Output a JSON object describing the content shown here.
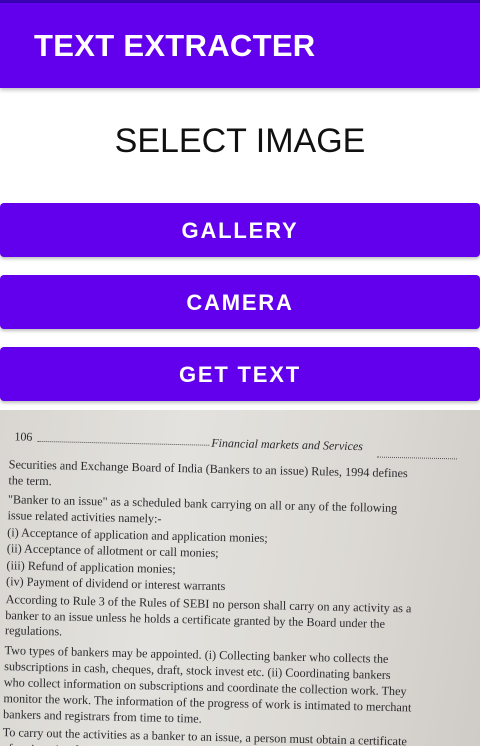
{
  "app_bar": {
    "title": "TEXT EXTRACTER"
  },
  "heading": "SELECT IMAGE",
  "buttons": {
    "gallery": "GALLERY",
    "camera": "CAMERA",
    "get_text": "GET TEXT"
  },
  "photo": {
    "page_number": "106",
    "running_header": "Financial markets and Services",
    "lines": [
      "Securities and Exchange Board of India (Bankers to an issue) Rules, 1994 defines",
      "the term.",
      "\"Banker to an issue\" as a scheduled bank carrying on all or any of the following",
      "issue related activities namely:-",
      "(i) Acceptance of application and application monies;",
      "(ii) Acceptance of allotment or call monies;",
      "(iii) Refund of application monies;",
      "(iv) Payment of dividend or interest warrants",
      "According to Rule 3 of the Rules of SEBI no person shall carry on any activity as a",
      "banker to an issue unless he holds a certificate granted by the Board under the",
      "regulations.",
      "Two types of bankers may be appointed. (i) Collecting banker who collects the",
      "subscriptions in cash, cheques, draft, stock invest etc. (ii) Coordinating bankers",
      "who collect information on subscriptions and coordinate the collection work. They",
      "monitor the work. The information of the progress of work is intimated to merchant",
      "bankers and registrars from time to time.",
      "To carry out the activities as a banker to an issue, a person must obtain a certificate",
      "of registration from SEBI. Every banker to an issue is required to pay to the SEBI an"
    ]
  },
  "colors": {
    "primary": "#6200ee",
    "primary_dark": "#3700b3",
    "on_primary": "#ffffff"
  }
}
